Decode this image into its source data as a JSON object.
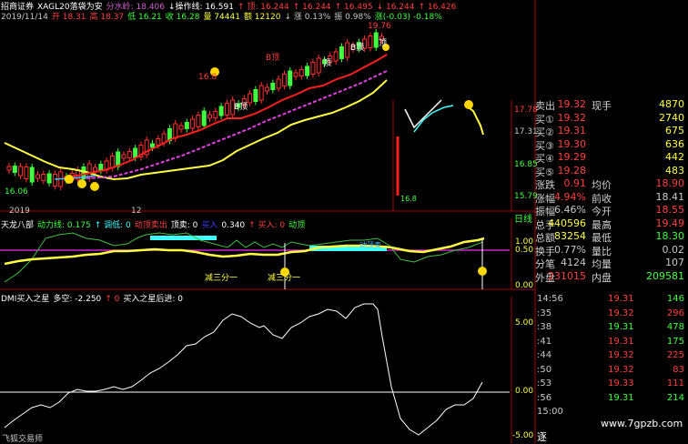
{
  "header": {
    "app": "招商证券",
    "indicator": "XAGL20落袋为安",
    "line1_items": [
      {
        "text": "分水岭: 18.406",
        "color": "#d060d0"
      },
      {
        "text": "↓操作线: 16.591",
        "color": "#ffffff"
      },
      {
        "text": "↑ 顶: 16.244",
        "color": "#ff4040"
      },
      {
        "text": "↑ 16.244",
        "color": "#ff4040"
      },
      {
        "text": "↑ 16.495",
        "color": "#ff4040"
      },
      {
        "text": "↓ 16.244",
        "color": "#ff4040"
      },
      {
        "text": "↑ 16.426",
        "color": "#ff4040"
      }
    ],
    "date": "2019/11/14",
    "line2_items": [
      {
        "text": "开 18.31",
        "color": "#ff4040"
      },
      {
        "text": "高 18.37",
        "color": "#ff4040"
      },
      {
        "text": "低 16.21",
        "color": "#40ff40"
      },
      {
        "text": "收 16.28",
        "color": "#40ff40"
      },
      {
        "text": "量 74441",
        "color": "#ffff40"
      },
      {
        "text": "额 12120",
        "color": "#ffff40"
      },
      {
        "text": "↓ 涨 0.13%",
        "color": "#c8c8c8"
      },
      {
        "text": "振 0.98%",
        "color": "#c8c8c8"
      },
      {
        "text": "涨(-0.03) -0.18%",
        "color": "#40ff40"
      }
    ]
  },
  "main_chart": {
    "peak_label": "19.76",
    "low_label": "16.06",
    "mark_labels": [
      "顶",
      "B顶",
      "B顶",
      "B顶",
      "16.8",
      "顶"
    ],
    "x_labels": [
      "2019",
      "12"
    ],
    "right_axis": [
      "17.78",
      "17.31",
      "16.85",
      "15.79",
      "16.8"
    ]
  },
  "sub_panel1": {
    "title": "天龙八部",
    "items": [
      {
        "text": "动力线: 0.175",
        "color": "#40ff40"
      },
      {
        "text": "↑ 调低: 0",
        "color": "#40ffff"
      },
      {
        "text": "动顶卖出",
        "color": "#ff4040"
      },
      {
        "text": "顶卖: 0",
        "color": "#ffffff"
      },
      {
        "text": "买入",
        "color": "#4040ff"
      },
      {
        "text": "0.340",
        "color": "#ffffff"
      },
      {
        "text": "↑ 买入: 0",
        "color": "#ff4040"
      },
      {
        "text": "动顶",
        "color": "#40ff40"
      }
    ],
    "labels": [
      "减三分一",
      "减三分一",
      "动顶卖"
    ],
    "right_axis": [
      "1.00",
      "0.50",
      "0.00"
    ],
    "tab": "日线"
  },
  "sub_panel2": {
    "title": "DMI买入之星",
    "items": [
      {
        "text": "多空: -2.250",
        "color": "#ffffff"
      },
      {
        "text": "↑ 0",
        "color": "#ff4040"
      },
      {
        "text": "买入之星后进: 0",
        "color": "#ffffff"
      }
    ],
    "right_axis": [
      "5.00",
      "0.00",
      "-5.00"
    ],
    "footer": "飞狐交易师"
  },
  "quote": {
    "rows": [
      {
        "l": "卖出",
        "v": "19.32",
        "l2": "现手",
        "v2": "4870",
        "c": "#ff4040",
        "c2": "#ffff40"
      },
      {
        "l": "买①",
        "v": "19.32",
        "l2": "",
        "v2": "2740",
        "c": "#ff4040",
        "c2": "#ffff40"
      },
      {
        "l": "买②",
        "v": "19.31",
        "l2": "",
        "v2": "675",
        "c": "#ff4040",
        "c2": "#ffff40"
      },
      {
        "l": "买③",
        "v": "19.30",
        "l2": "",
        "v2": "636",
        "c": "#ff4040",
        "c2": "#ffff40"
      },
      {
        "l": "买④",
        "v": "19.29",
        "l2": "",
        "v2": "442",
        "c": "#ff4040",
        "c2": "#ffff40"
      },
      {
        "l": "买⑤",
        "v": "19.28",
        "l2": "",
        "v2": "483",
        "c": "#ff4040",
        "c2": "#ffff40"
      },
      {
        "l": "涨跌",
        "v": "0.91",
        "l2": "均价",
        "v2": "18.90",
        "c": "#ff4040",
        "c2": "#ff4040"
      },
      {
        "l": "涨幅",
        "v": "4.94%",
        "l2": "前收",
        "v2": "18.41",
        "c": "#ff4040",
        "c2": "#c8c8c8"
      },
      {
        "l": "振幅",
        "v": "6.46%",
        "l2": "今开",
        "v2": "18.55",
        "c": "#c8c8c8",
        "c2": "#ff4040"
      },
      {
        "l": "总手",
        "v": "440596",
        "l2": "最高",
        "v2": "19.49",
        "c": "#ffff40",
        "c2": "#ff4040"
      },
      {
        "l": "总额",
        "v": "83254",
        "l2": "最低",
        "v2": "18.30",
        "c": "#ffff40",
        "c2": "#40ff40"
      },
      {
        "l": "换手",
        "v": "0.77%",
        "l2": "量比",
        "v2": "0.02",
        "c": "#c8c8c8",
        "c2": "#c8c8c8"
      },
      {
        "l": "分笔",
        "v": "4124",
        "l2": "均量",
        "v2": "107",
        "c": "#c8c8c8",
        "c2": "#c8c8c8"
      },
      {
        "l": "外盘",
        "v": "231015",
        "l2": "内盘",
        "v2": "209581",
        "c": "#ff4040",
        "c2": "#40ff40"
      }
    ],
    "ticks": [
      {
        "t": "14:56",
        "p": "19.31",
        "a": "↑",
        "v": "146",
        "ac": "#ff4040",
        "vc": "#40ff40",
        "tt": "↑"
      },
      {
        "t": ":35",
        "p": "19.32",
        "a": "↑",
        "v": "296",
        "ac": "#ff4040",
        "vc": "#ff4040",
        "tt": ""
      },
      {
        "t": ":38",
        "p": "19.31",
        "a": "↓",
        "v": "478",
        "ac": "#40ff40",
        "vc": "#40ff40",
        "tt": ""
      },
      {
        "t": ":41",
        "p": "19.31",
        "a": "",
        "v": "175",
        "ac": "#ff4040",
        "vc": "#40ff40",
        "tt": ""
      },
      {
        "t": ":44",
        "p": "19.32",
        "a": "↑",
        "v": "225",
        "ac": "#ff4040",
        "vc": "#ff4040",
        "tt": ""
      },
      {
        "t": ":50",
        "p": "19.32",
        "a": "↑",
        "v": "83",
        "ac": "#ff4040",
        "vc": "#ff4040",
        "tt": ""
      },
      {
        "t": ":53",
        "p": "19.33",
        "a": "↑",
        "v": "111",
        "ac": "#ff4040",
        "vc": "#ff4040",
        "tt": ""
      },
      {
        "t": ":56",
        "p": "19.31",
        "a": "↓",
        "v": "214",
        "ac": "#40ff40",
        "vc": "#40ff40",
        "tt": ""
      },
      {
        "t": "15:00",
        "p": "",
        "a": "",
        "v": "",
        "ac": "#c8c8c8",
        "vc": "#c8c8c8",
        "tt": ""
      }
    ],
    "footer_label": "逐"
  },
  "watermark": "www.7gpzb.com",
  "colors": {
    "up": "#ff4040",
    "down": "#40ff40",
    "yellow": "#ffff40",
    "bg": "#000000"
  }
}
